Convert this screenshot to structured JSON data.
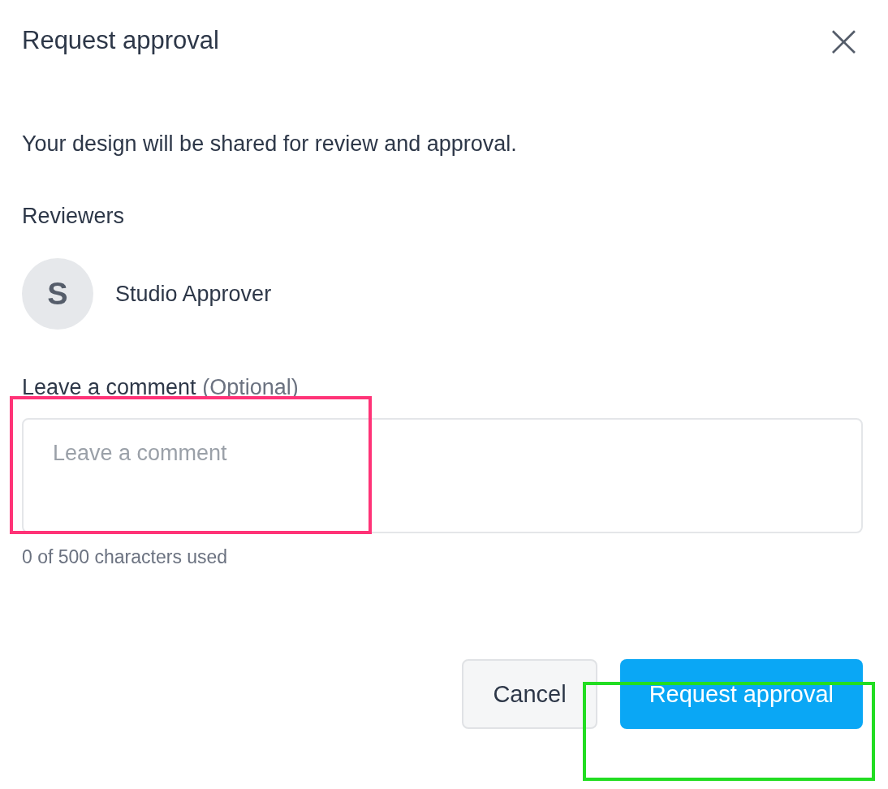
{
  "dialog": {
    "title": "Request approval",
    "close_glyph": "×"
  },
  "message": "Your design will be shared for review and approval.",
  "reviewers": {
    "label": "Reviewers",
    "items": [
      {
        "initial": "S",
        "name": "Studio Approver"
      }
    ]
  },
  "comment": {
    "label": "Leave a comment",
    "optional": "(Optional)",
    "placeholder": "Leave a comment",
    "counter": "0 of 500 characters used"
  },
  "buttons": [
    {
      "label": "Cancel",
      "kind": "secondary"
    },
    {
      "label": "Request approval",
      "kind": "primary"
    }
  ],
  "annotations": [
    {
      "color": "#ff3377"
    },
    {
      "color": "#22dd22"
    }
  ]
}
